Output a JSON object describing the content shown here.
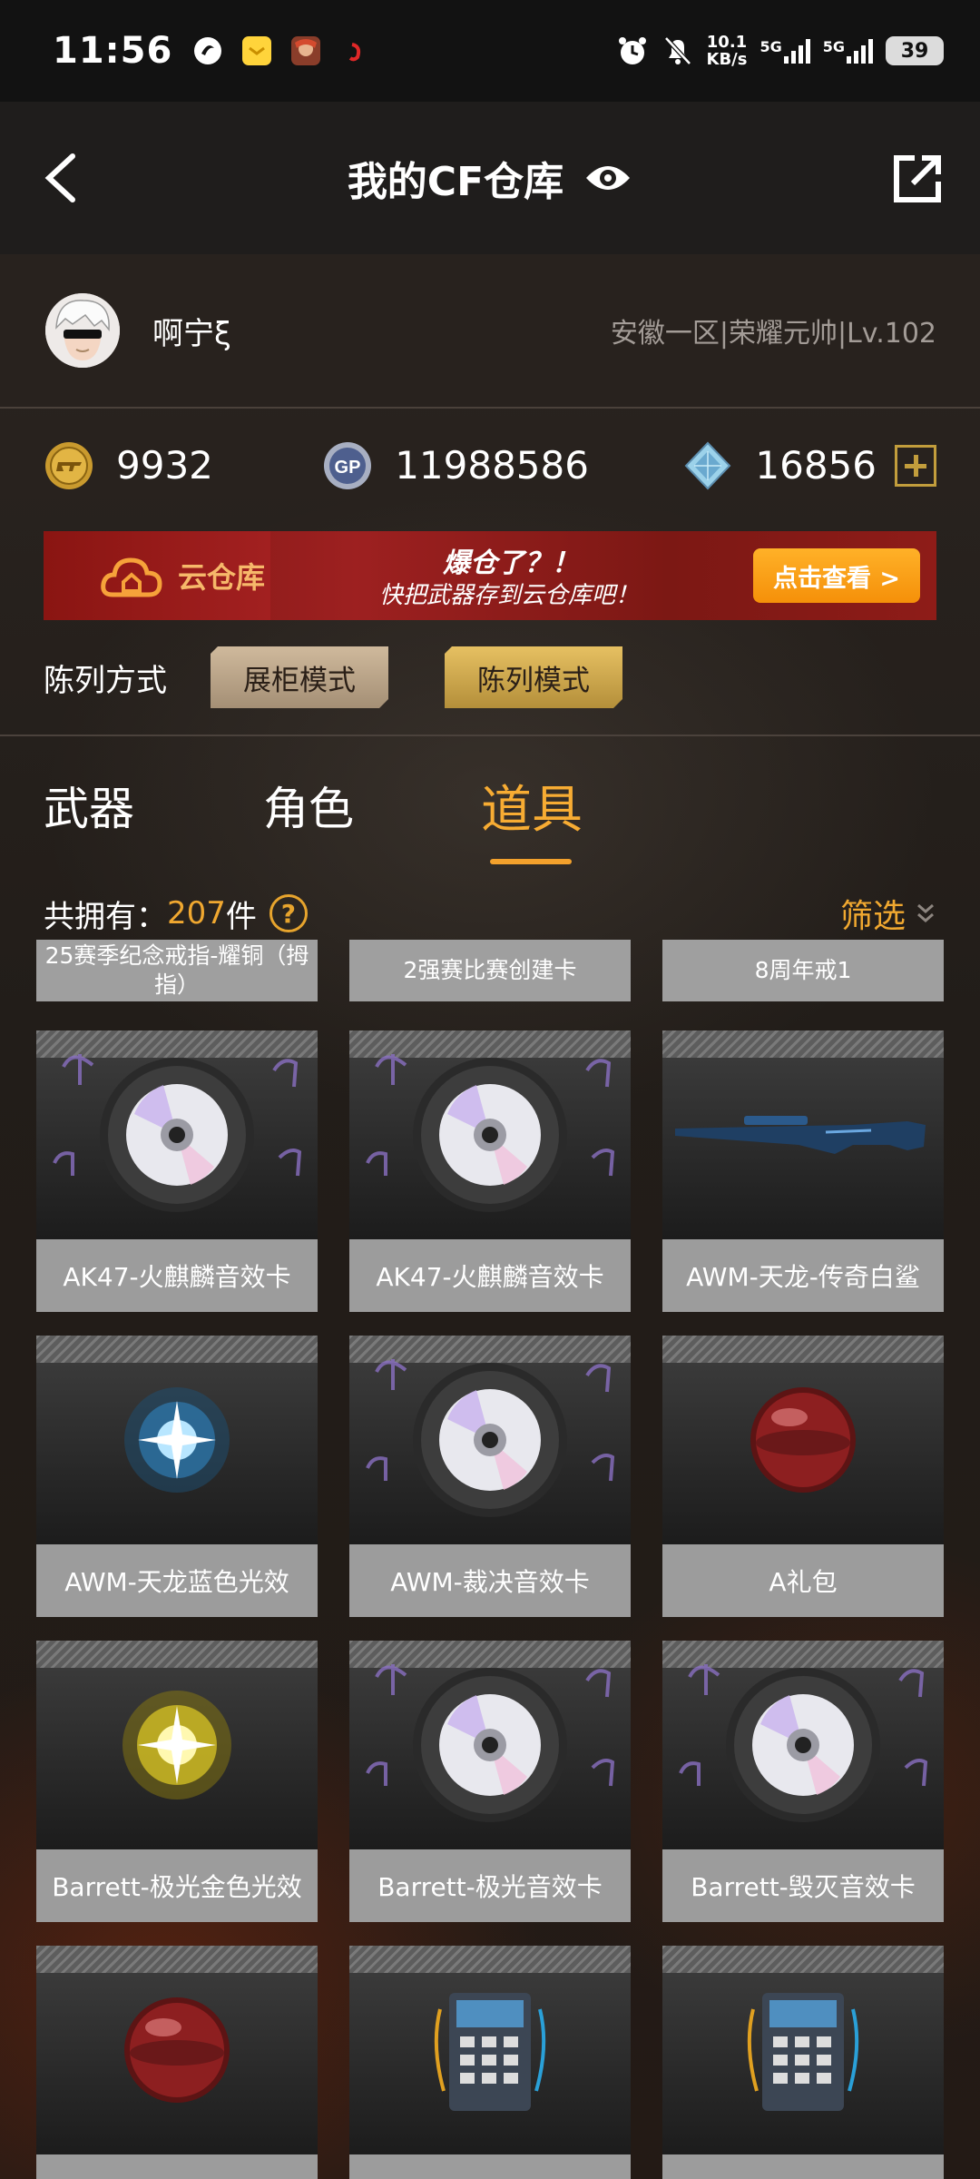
{
  "status_bar": {
    "time": "11:56",
    "net_speed_value": "10.1",
    "net_speed_unit": "KB/s",
    "signal1": "5G",
    "signal2": "5G",
    "battery": "39"
  },
  "header": {
    "title": "我的CF仓库"
  },
  "profile": {
    "nickname": "啊宁ξ",
    "server_info": "安徽一区|荣耀元帅|Lv.102"
  },
  "currency": {
    "cf_points": "9932",
    "gp": "11988586",
    "diamonds": "16856"
  },
  "banner": {
    "label": "云仓库",
    "headline": "爆仓了？！",
    "subline": "快把武器存到云仓库吧！",
    "button": "点击查看 >"
  },
  "arrange": {
    "label": "陈列方式",
    "modes": [
      "展柜模式",
      "陈列模式"
    ],
    "active_mode": "陈列模式"
  },
  "tabs": {
    "items": [
      "武器",
      "角色",
      "道具"
    ],
    "active": "道具"
  },
  "count": {
    "label": "共拥有：",
    "value": "207",
    "unit": "件",
    "filter_label": "筛选"
  },
  "grid": {
    "partial_row": [
      "25赛季纪念戒指-耀铜（拇指）",
      "2强赛比赛创建卡",
      "8周年戒1"
    ],
    "cards": [
      {
        "label": "AK47-火麒麟音效卡",
        "icon": "music-disc-icon"
      },
      {
        "label": "AK47-火麒麟音效卡",
        "icon": "music-disc-icon"
      },
      {
        "label": "AWM-天龙-传奇白鲨",
        "icon": "sniper-rifle-icon"
      },
      {
        "label": "AWM-天龙蓝色光效",
        "icon": "blue-glow-icon"
      },
      {
        "label": "AWM-裁决音效卡",
        "icon": "music-disc-icon"
      },
      {
        "label": "A礼包",
        "icon": "red-orb-icon"
      },
      {
        "label": "Barrett-极光金色光效",
        "icon": "gold-glow-icon"
      },
      {
        "label": "Barrett-极光音效卡",
        "icon": "music-disc-icon"
      },
      {
        "label": "Barrett-毁灭音效卡",
        "icon": "music-disc-icon"
      },
      {
        "label": "",
        "icon": "red-orb-icon"
      },
      {
        "label": "",
        "icon": "device-icon"
      },
      {
        "label": "",
        "icon": "device-icon"
      }
    ]
  },
  "colors": {
    "accent": "#f7ac33",
    "card_bg": "#9c9c9c",
    "banner_red": "#9d2020"
  }
}
